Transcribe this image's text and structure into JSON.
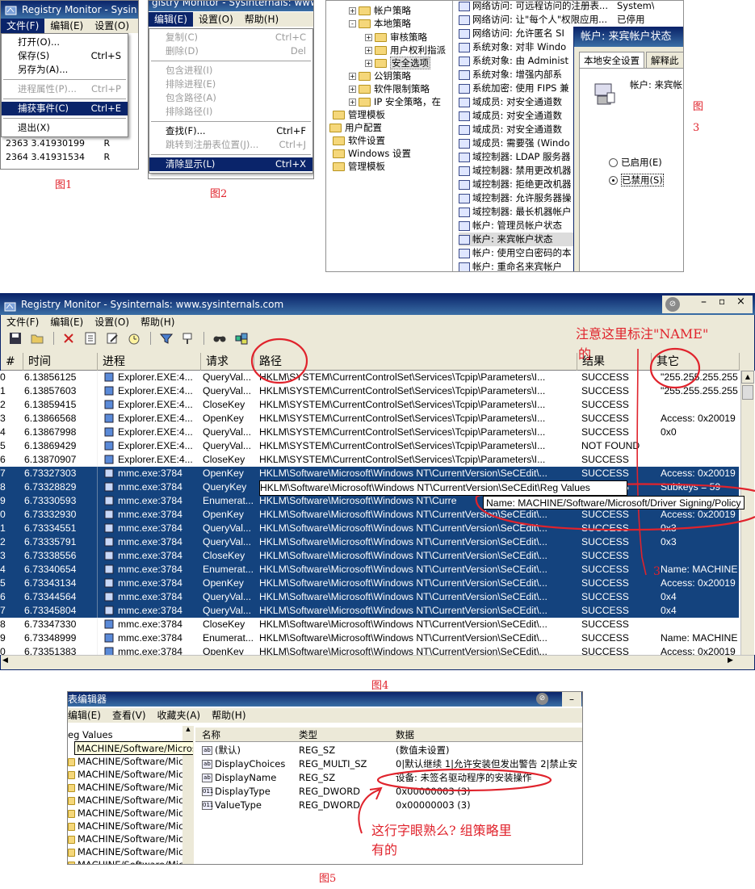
{
  "fig1": {
    "title": "Registry Monitor - Sysin",
    "menus": [
      "文件(F)",
      "编辑(E)",
      "设置(O)",
      "帮"
    ],
    "items": [
      {
        "label": "打开(O)...",
        "shortcut": "",
        "state": "normal"
      },
      {
        "label": "保存(S)",
        "shortcut": "Ctrl+S",
        "state": "normal"
      },
      {
        "label": "另存为(A)...",
        "shortcut": "",
        "state": "normal"
      },
      {
        "sep": true
      },
      {
        "label": "进程属性(P)...",
        "shortcut": "Ctrl+P",
        "state": "disabled"
      },
      {
        "sep": true
      },
      {
        "label": "捕获事件(C)",
        "shortcut": "Ctrl+E",
        "state": "selected"
      },
      {
        "sep": true
      },
      {
        "label": "退出(X)",
        "shortcut": "",
        "state": "normal"
      }
    ],
    "bg_rows": [
      {
        "num": "2363",
        "time": "3.41930199"
      },
      {
        "num": "2364",
        "time": "3.41931534"
      }
    ],
    "caption": "图1"
  },
  "fig2": {
    "title": "gistry Monitor - Sysinternals: www.s",
    "menus": [
      "编辑(E)",
      "设置(O)",
      "帮助(H)"
    ],
    "items": [
      {
        "label": "复制(C)",
        "shortcut": "Ctrl+C",
        "state": "disabled"
      },
      {
        "label": "删除(D)",
        "shortcut": "Del",
        "state": "disabled"
      },
      {
        "sep": true
      },
      {
        "label": "包含进程(I)",
        "shortcut": "",
        "state": "disabled"
      },
      {
        "label": "排除进程(E)",
        "shortcut": "",
        "state": "disabled"
      },
      {
        "label": "包含路径(A)",
        "shortcut": "",
        "state": "disabled"
      },
      {
        "label": "排除路径(I)",
        "shortcut": "",
        "state": "disabled"
      },
      {
        "sep": true
      },
      {
        "label": "查找(F)...",
        "shortcut": "Ctrl+F",
        "state": "normal"
      },
      {
        "label": "跳转到注册表位置(J)...",
        "shortcut": "Ctrl+J",
        "state": "disabled"
      },
      {
        "sep": true
      },
      {
        "label": "清除显示(L)",
        "shortcut": "Ctrl+X",
        "state": "selected"
      }
    ],
    "caption": "图2"
  },
  "fig3": {
    "tree": [
      {
        "label": "帐户策略",
        "depth": 2,
        "expander": "+"
      },
      {
        "label": "本地策略",
        "depth": 2,
        "expander": "-"
      },
      {
        "label": "审核策略",
        "depth": 3,
        "expander": "+"
      },
      {
        "label": "用户权利指派",
        "depth": 3,
        "expander": "+"
      },
      {
        "label": "安全选项",
        "depth": 3,
        "expander": "+",
        "selected": true
      },
      {
        "label": "公钥策略",
        "depth": 2,
        "expander": "+"
      },
      {
        "label": "软件限制策略",
        "depth": 2,
        "expander": "+"
      },
      {
        "label": "IP 安全策略，在",
        "depth": 2,
        "expander": "+"
      },
      {
        "label": "管理模板",
        "depth": 1,
        "expander": ""
      },
      {
        "label": "用户配置",
        "depth": 0,
        "expander": ""
      },
      {
        "label": "软件设置",
        "depth": 1,
        "expander": ""
      },
      {
        "label": "Windows 设置",
        "depth": 1,
        "expander": ""
      },
      {
        "label": "管理模板",
        "depth": 1,
        "expander": ""
      }
    ],
    "policies": [
      {
        "name": "网络访问: 可远程访问的注册表...",
        "setting": "System\\Curren"
      },
      {
        "name": "网络访问: 让\"每个人\"权限应用...",
        "setting": "已停用"
      },
      {
        "name": "网络访问: 允许匿名 SI",
        "setting": ""
      },
      {
        "name": "系统对象: 对非 Windo",
        "setting": ""
      },
      {
        "name": "系统对象: 由 Administ",
        "setting": ""
      },
      {
        "name": "系统对象: 增强内部系",
        "setting": ""
      },
      {
        "name": "系统加密: 使用 FIPS 兼",
        "setting": ""
      },
      {
        "name": "域成员: 对安全通道数",
        "setting": ""
      },
      {
        "name": "域成员: 对安全通道数",
        "setting": ""
      },
      {
        "name": "域成员: 对安全通道数",
        "setting": ""
      },
      {
        "name": "域成员: 需要强 (Windo",
        "setting": ""
      },
      {
        "name": "域控制器: LDAP 服务器",
        "setting": ""
      },
      {
        "name": "域控制器: 禁用更改机器",
        "setting": ""
      },
      {
        "name": "域控制器: 拒绝更改机器",
        "setting": ""
      },
      {
        "name": "域控制器: 允许服务器操",
        "setting": ""
      },
      {
        "name": "域控制器: 最长机器帐户",
        "setting": ""
      },
      {
        "name": "帐户: 管理员帐户状态",
        "setting": ""
      },
      {
        "name": "帐户: 来宾帐户状态",
        "setting": ""
      },
      {
        "name": "帐户: 使用空白密码的本",
        "setting": ""
      },
      {
        "name": "帐户: 重命名来宾帐户",
        "setting": ""
      }
    ],
    "dialog": {
      "title": "帐户: 来宾帐户状态",
      "tabs": [
        "本地安全设置",
        "解释此"
      ],
      "label": "帐户: 来宾帐",
      "enabled": "已启用(E)",
      "disabled": "已禁用(S)"
    },
    "caption": "图",
    "caption_num": "3"
  },
  "fig4": {
    "title": "Registry Monitor - Sysinternals: www.sysinternals.com",
    "menus": [
      "文件(F)",
      "编辑(E)",
      "设置(O)",
      "帮助(H)"
    ],
    "columns": [
      "#",
      "时间",
      "进程",
      "请求",
      "路径",
      "结果",
      "其它"
    ],
    "rows": [
      {
        "n": "0",
        "t": "6.13856125",
        "p": "Explorer.EXE:4...",
        "r": "QueryVal...",
        "path": "HKLM\\SYSTEM\\CurrentControlSet\\Services\\Tcpip\\Parameters\\I...",
        "res": "SUCCESS",
        "o": "\"255.255.255.255",
        "sel": false
      },
      {
        "n": "1",
        "t": "6.13857603",
        "p": "Explorer.EXE:4...",
        "r": "QueryVal...",
        "path": "HKLM\\SYSTEM\\CurrentControlSet\\Services\\Tcpip\\Parameters\\I...",
        "res": "SUCCESS",
        "o": "\"255.255.255.255",
        "sel": false
      },
      {
        "n": "2",
        "t": "6.13859415",
        "p": "Explorer.EXE:4...",
        "r": "CloseKey",
        "path": "HKLM\\SYSTEM\\CurrentControlSet\\Services\\Tcpip\\Parameters\\I...",
        "res": "SUCCESS",
        "o": "",
        "sel": false
      },
      {
        "n": "3",
        "t": "6.13866568",
        "p": "Explorer.EXE:4...",
        "r": "OpenKey",
        "path": "HKLM\\SYSTEM\\CurrentControlSet\\Services\\Tcpip\\Parameters\\I...",
        "res": "SUCCESS",
        "o": "Access: 0x20019",
        "sel": false
      },
      {
        "n": "4",
        "t": "6.13867998",
        "p": "Explorer.EXE:4...",
        "r": "QueryVal...",
        "path": "HKLM\\SYSTEM\\CurrentControlSet\\Services\\Tcpip\\Parameters\\I...",
        "res": "SUCCESS",
        "o": "0x0",
        "sel": false
      },
      {
        "n": "5",
        "t": "6.13869429",
        "p": "Explorer.EXE:4...",
        "r": "QueryVal...",
        "path": "HKLM\\SYSTEM\\CurrentControlSet\\Services\\Tcpip\\Parameters\\I...",
        "res": "NOT FOUND",
        "o": "",
        "sel": false
      },
      {
        "n": "6",
        "t": "6.13870907",
        "p": "Explorer.EXE:4...",
        "r": "CloseKey",
        "path": "HKLM\\SYSTEM\\CurrentControlSet\\Services\\Tcpip\\Parameters\\I...",
        "res": "SUCCESS",
        "o": "",
        "sel": false
      },
      {
        "n": "7",
        "t": "6.73327303",
        "p": "mmc.exe:3784",
        "r": "OpenKey",
        "path": "HKLM\\Software\\Microsoft\\Windows NT\\CurrentVersion\\SeCEdit\\...",
        "res": "SUCCESS",
        "o": "Access: 0x20019",
        "sel": true
      },
      {
        "n": "8",
        "t": "6.73328829",
        "p": "mmc.exe:3784",
        "r": "QueryKey",
        "path": "HKLM\\Software\\Microsoft\\Windows NT\\CurrentVersion\\SeCEdit\\Reg Values",
        "res": "SUCCESS",
        "o": "Subkeys = 59",
        "sel": true,
        "pathbox": true
      },
      {
        "n": "9",
        "t": "6.73330593",
        "p": "mmc.exe:3784",
        "r": "Enumerat...",
        "path": "HKLM\\Software\\Microsoft\\Windows NT\\Curre",
        "res": "",
        "o": "",
        "sel": true
      },
      {
        "n": "0",
        "t": "6.73332930",
        "p": "mmc.exe:3784",
        "r": "OpenKey",
        "path": "HKLM\\Software\\Microsoft\\Windows NT\\CurrentVersion\\SeCEdit\\...",
        "res": "SUCCESS",
        "o": "Access: 0x20019",
        "sel": true
      },
      {
        "n": "1",
        "t": "6.73334551",
        "p": "mmc.exe:3784",
        "r": "QueryVal...",
        "path": "HKLM\\Software\\Microsoft\\Windows NT\\CurrentVersion\\SeCEdit\\...",
        "res": "SUCCESS",
        "o": "0x3",
        "sel": true
      },
      {
        "n": "2",
        "t": "6.73335791",
        "p": "mmc.exe:3784",
        "r": "QueryVal...",
        "path": "HKLM\\Software\\Microsoft\\Windows NT\\CurrentVersion\\SeCEdit\\...",
        "res": "SUCCESS",
        "o": "0x3",
        "sel": true
      },
      {
        "n": "3",
        "t": "6.73338556",
        "p": "mmc.exe:3784",
        "r": "CloseKey",
        "path": "HKLM\\Software\\Microsoft\\Windows NT\\CurrentVersion\\SeCEdit\\...",
        "res": "SUCCESS",
        "o": "",
        "sel": true
      },
      {
        "n": "4",
        "t": "6.73340654",
        "p": "mmc.exe:3784",
        "r": "Enumerat...",
        "path": "HKLM\\Software\\Microsoft\\Windows NT\\CurrentVersion\\SeCEdit\\...",
        "res": "SUCCESS",
        "o": "Name: MACHINE",
        "sel": true
      },
      {
        "n": "5",
        "t": "6.73343134",
        "p": "mmc.exe:3784",
        "r": "OpenKey",
        "path": "HKLM\\Software\\Microsoft\\Windows NT\\CurrentVersion\\SeCEdit\\...",
        "res": "SUCCESS",
        "o": "Access: 0x20019",
        "sel": true
      },
      {
        "n": "6",
        "t": "6.73344564",
        "p": "mmc.exe:3784",
        "r": "QueryVal...",
        "path": "HKLM\\Software\\Microsoft\\Windows NT\\CurrentVersion\\SeCEdit\\...",
        "res": "SUCCESS",
        "o": "0x4",
        "sel": true
      },
      {
        "n": "7",
        "t": "6.73345804",
        "p": "mmc.exe:3784",
        "r": "QueryVal...",
        "path": "HKLM\\Software\\Microsoft\\Windows NT\\CurrentVersion\\SeCEdit\\...",
        "res": "SUCCESS",
        "o": "0x4",
        "sel": true
      },
      {
        "n": "8",
        "t": "6.73347330",
        "p": "mmc.exe:3784",
        "r": "CloseKey",
        "path": "HKLM\\Software\\Microsoft\\Windows NT\\CurrentVersion\\SeCEdit\\...",
        "res": "SUCCESS",
        "o": "",
        "sel": false
      },
      {
        "n": "9",
        "t": "6.73348999",
        "p": "mmc.exe:3784",
        "r": "Enumerat...",
        "path": "HKLM\\Software\\Microsoft\\Windows NT\\CurrentVersion\\SeCEdit\\...",
        "res": "SUCCESS",
        "o": "Name: MACHINE",
        "sel": false
      },
      {
        "n": "0",
        "t": "6.73351383",
        "p": "mmc.exe:3784",
        "r": "OpenKey",
        "path": "HKLM\\Software\\Microsoft\\Windows NT\\CurrentVersion\\SeCEdit\\...",
        "res": "SUCCESS",
        "o": "Access: 0x20019",
        "sel": false
      }
    ],
    "tooltip": "Name: MACHINE/Software/Microsoft/Driver Signing/Policy",
    "annotation": "注意这里标注\"NAME\"",
    "annotation2": "的",
    "annotation_mark": "3",
    "caption": "图4"
  },
  "fig5": {
    "title": "表编辑器",
    "menus": [
      "编辑(E)",
      "查看(V)",
      "收藏夹(A)",
      "帮助(H)"
    ],
    "tree_root": "eg Values",
    "tree_tooltip": "MACHINE/Software/Microsoft/Driver Signing/Policy",
    "tree_items": [
      "MACHINE/Software/Mic",
      "MACHINE/Software/Mic",
      "MACHINE/Software/Mic",
      "MACHINE/Software/Mic",
      "MACHINE/Software/Mic",
      "MACHINE/Software/Mic",
      "MACHINE/Software/Mic",
      "MACHINE/Software/Mic",
      "MACHINE/Software/Mic"
    ],
    "columns": [
      "名称",
      "类型",
      "数据"
    ],
    "values": [
      {
        "name": "(默认)",
        "type": "REG_SZ",
        "data": "(数值未设置)",
        "icon": "ab"
      },
      {
        "name": "DisplayChoices",
        "type": "REG_MULTI_SZ",
        "data": "0|默认继续 1|允许安装但发出警告 2|禁止安",
        "icon": "ab"
      },
      {
        "name": "DisplayName",
        "type": "REG_SZ",
        "data": "设备: 未签名驱动程序的安装操作",
        "icon": "ab"
      },
      {
        "name": "DisplayType",
        "type": "REG_DWORD",
        "data": "0x00000003 (3)",
        "icon": "011"
      },
      {
        "name": "ValueType",
        "type": "REG_DWORD",
        "data": "0x00000003 (3)",
        "icon": "011"
      }
    ],
    "note_line1": "这行字眼熟么? 组策略里",
    "note_line2": "有的",
    "caption": "图5"
  }
}
